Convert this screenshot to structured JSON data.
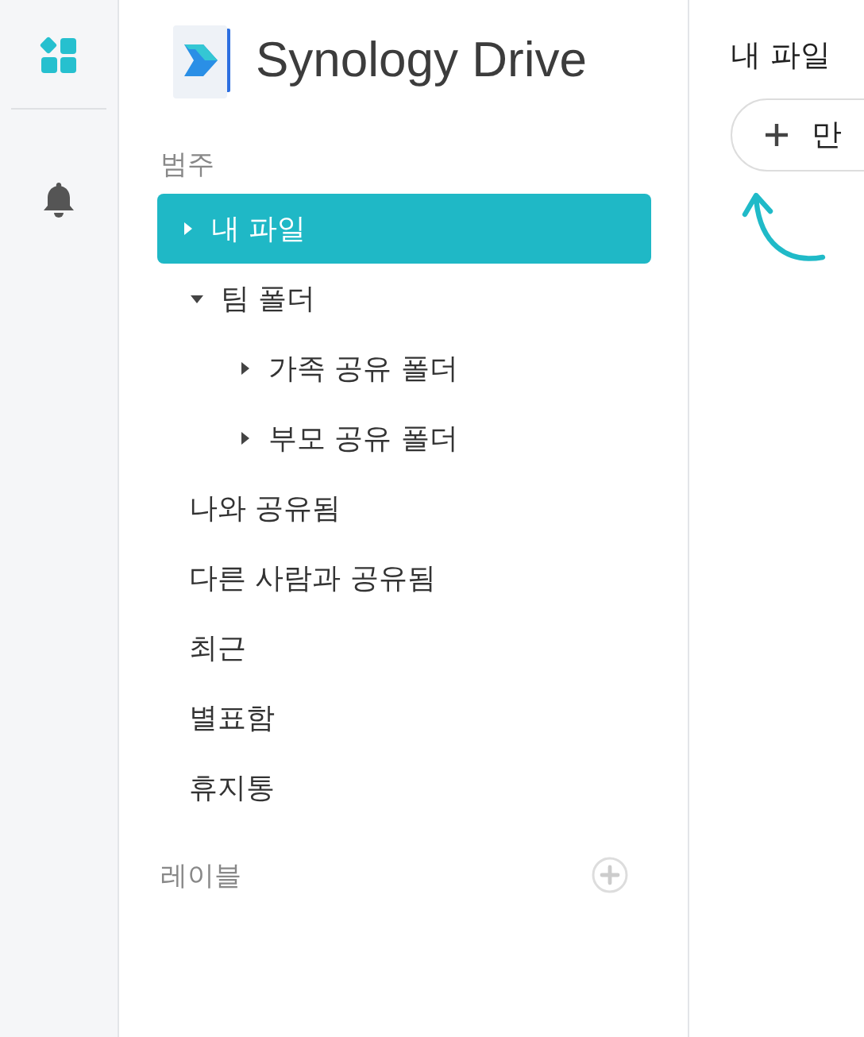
{
  "app": {
    "title": "Synology Drive"
  },
  "sidebar": {
    "category_heading": "범주",
    "items": [
      {
        "label": "내 파일",
        "selected": true,
        "expanded": false
      },
      {
        "label": "팀 폴더",
        "selected": false,
        "expanded": true,
        "children": [
          {
            "label": "가족 공유 폴더",
            "selected": false,
            "expanded": false
          },
          {
            "label": "부모 공유 폴더",
            "selected": false,
            "expanded": false
          }
        ]
      },
      {
        "label": "나와 공유됨",
        "selected": false
      },
      {
        "label": "다른 사람과 공유됨",
        "selected": false
      },
      {
        "label": "최근",
        "selected": false
      },
      {
        "label": "별표함",
        "selected": false
      },
      {
        "label": "휴지통",
        "selected": false
      }
    ],
    "labels_heading": "레이블"
  },
  "main": {
    "title": "내 파일",
    "create_button": "만"
  }
}
